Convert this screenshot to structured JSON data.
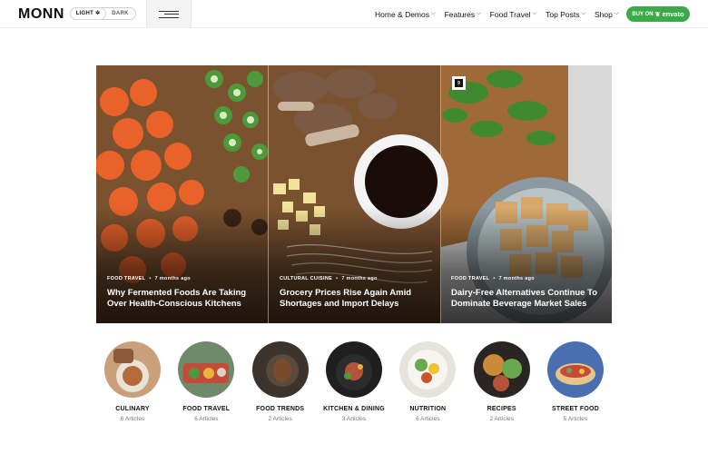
{
  "header": {
    "logo": "MONN",
    "mode": {
      "light_label": "LIGHT",
      "dark_label": "DARK"
    },
    "nav": [
      {
        "label": "Home & Demos"
      },
      {
        "label": "Features"
      },
      {
        "label": "Food Travel"
      },
      {
        "label": "Top Posts"
      },
      {
        "label": "Shop"
      }
    ],
    "buy_button": {
      "prefix": "BUY ON",
      "brand": "envato"
    }
  },
  "hero": {
    "badge_count": "9",
    "posts": [
      {
        "category": "FOOD TRAVEL",
        "date": "7 months ago",
        "title": "Why Fermented Foods Are Taking Over Health-Conscious Kitchens"
      },
      {
        "category": "CULTURAL CUISINE",
        "date": "7 months ago",
        "title": "Grocery Prices Rise Again Amid Shortages and Import Delays"
      },
      {
        "category": "FOOD TRAVEL",
        "date": "7 months ago",
        "title": "Dairy-Free Alternatives Continue To Dominate Beverage Market Sales"
      }
    ]
  },
  "categories": [
    {
      "name": "CULINARY",
      "count": "6 Articles"
    },
    {
      "name": "FOOD TRAVEL",
      "count": "6 Articles"
    },
    {
      "name": "FOOD TRENDS",
      "count": "2 Articles"
    },
    {
      "name": "KITCHEN & DINING",
      "count": "3 Articles"
    },
    {
      "name": "NUTRITION",
      "count": "6 Articles"
    },
    {
      "name": "RECIPES",
      "count": "2 Articles"
    },
    {
      "name": "STREET FOOD",
      "count": "5 Articles"
    }
  ],
  "colors": {
    "accent": "#3daa48",
    "text": "#111111",
    "muted": "#777777"
  }
}
